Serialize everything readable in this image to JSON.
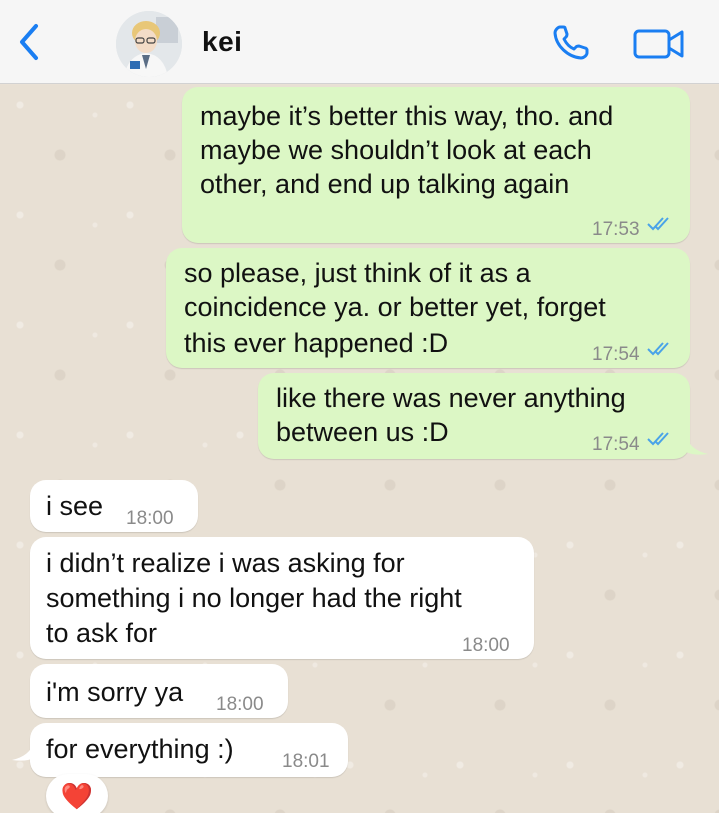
{
  "header": {
    "contact_name": "kei"
  },
  "messages": [
    {
      "direction": "outgoing",
      "lines": [
        "maybe it’s better this way, tho. and",
        "maybe we shouldn’t look at each",
        "other, and end up talking again"
      ],
      "time": "17:53",
      "read": true
    },
    {
      "direction": "outgoing",
      "lines": [
        "so please, just think of it as a",
        "coincidence ya. or better yet, forget",
        "this ever happened :D"
      ],
      "time": "17:54",
      "read": true
    },
    {
      "direction": "outgoing",
      "lines": [
        "like there was never anything",
        "between us :D"
      ],
      "time": "17:54",
      "read": true
    },
    {
      "direction": "incoming",
      "lines": [
        "i see"
      ],
      "time": "18:00"
    },
    {
      "direction": "incoming",
      "lines": [
        "i didn’t realize i was asking for",
        "something i no longer had the right",
        "to ask for"
      ],
      "time": "18:00"
    },
    {
      "direction": "incoming",
      "lines": [
        "i'm sorry ya"
      ],
      "time": "18:00"
    },
    {
      "direction": "incoming",
      "lines": [
        "for everything :)"
      ],
      "time": "18:01",
      "reaction": "❤️"
    }
  ],
  "colors": {
    "accent": "#1a7ef2",
    "outgoing_bubble": "#dcf7c5",
    "incoming_bubble": "#ffffff",
    "read_ticks": "#4aa3e8"
  },
  "icons": {
    "back": "chevron-left-icon",
    "call": "phone-icon",
    "video": "video-camera-icon",
    "read_receipt": "double-check-icon"
  }
}
